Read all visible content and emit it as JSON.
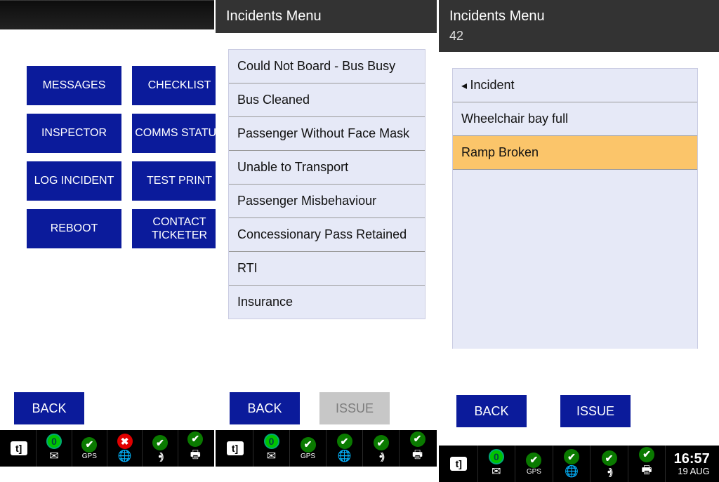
{
  "panel1": {
    "buttons": [
      "MESSAGES",
      "CHECKLIST",
      "INSPECTOR",
      "COMMS STATUS",
      "LOG INCIDENT",
      "TEST PRINT",
      "REBOOT",
      "CONTACT TICKETER"
    ],
    "back": "BACK"
  },
  "panel2": {
    "title": "Incidents Menu",
    "items": [
      "Could Not Board - Bus Busy",
      "Bus Cleaned",
      "Passenger Without Face Mask",
      "Unable to Transport",
      "Passenger Misbehaviour",
      "Concessionary Pass Retained",
      "RTI",
      "Insurance"
    ],
    "back": "BACK",
    "issue": "ISSUE"
  },
  "panel3": {
    "title": "Incidents Menu",
    "subtitle": "42",
    "header_item": "Incident",
    "items": [
      "Wheelchair bay full",
      "Ramp Broken"
    ],
    "selected_index": 1,
    "back": "BACK",
    "issue": "ISSUE",
    "clock": {
      "time": "16:57",
      "date": "19 AUG"
    }
  },
  "status": {
    "gps_label": "GPS",
    "msg_count": "0"
  }
}
